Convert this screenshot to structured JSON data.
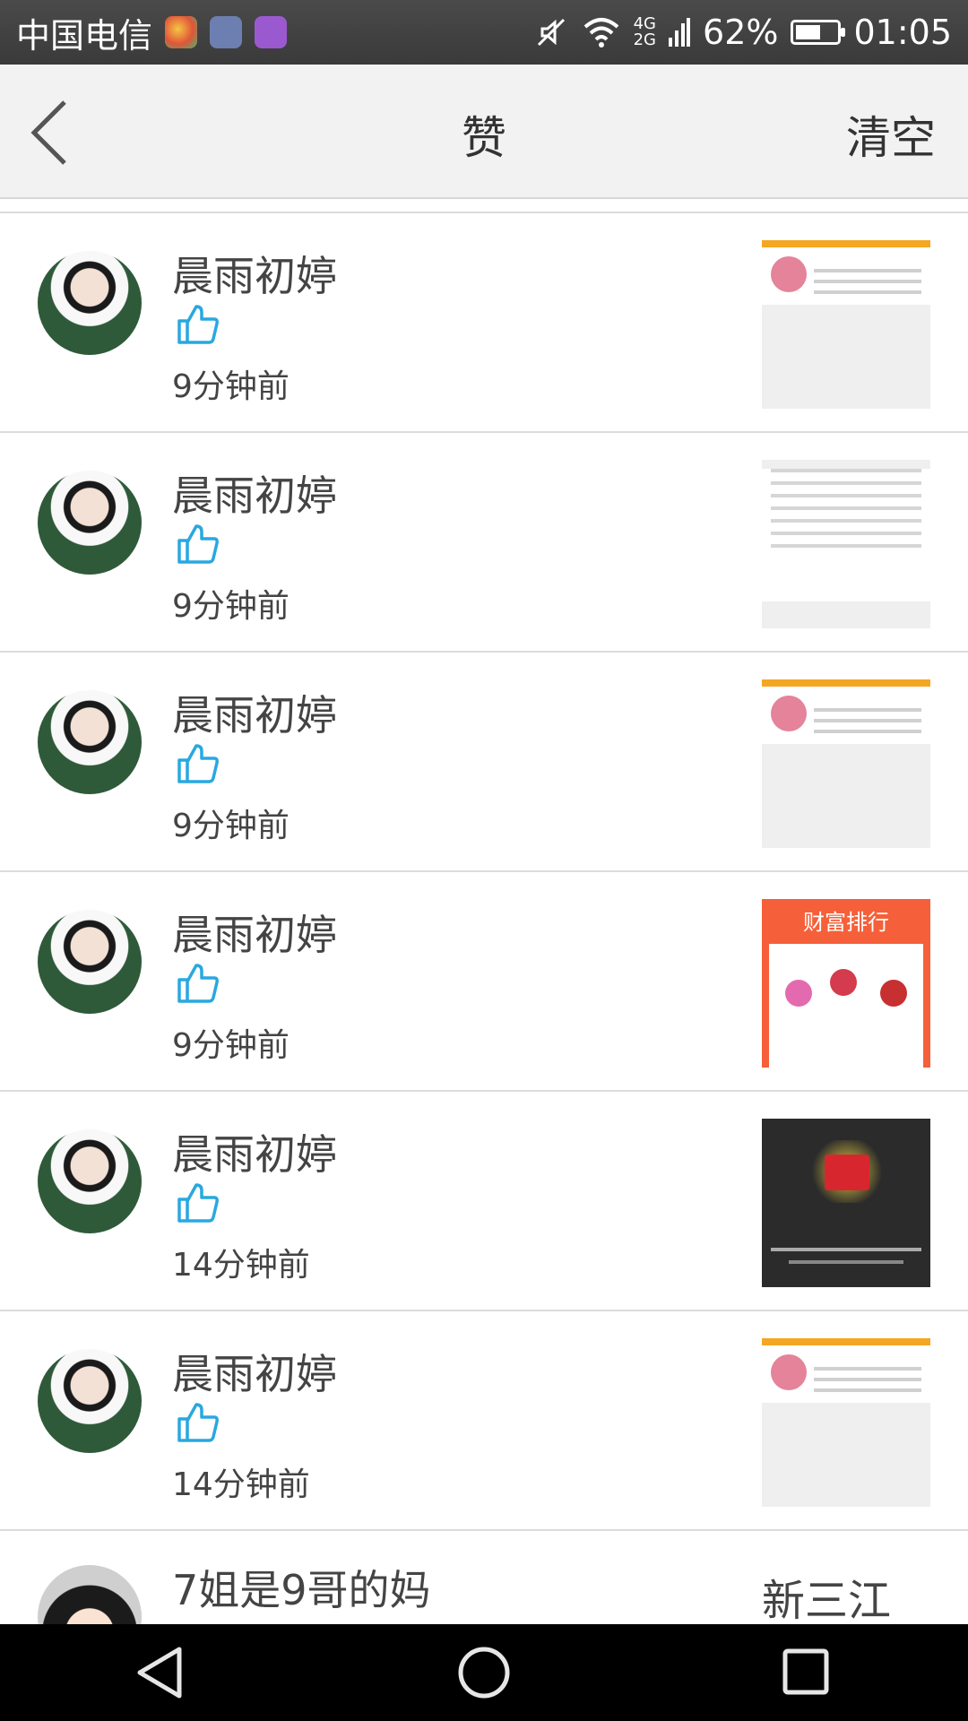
{
  "status_bar": {
    "carrier": "中国电信",
    "network_top": "4G",
    "network_bottom": "2G",
    "battery_percent": "62%",
    "battery_level": 0.62,
    "time": "01:05"
  },
  "header": {
    "title": "赞",
    "clear_label": "清空"
  },
  "likes": [
    {
      "user": "晨雨初婷",
      "time": "9分钟前",
      "thumbnail": "task-card"
    },
    {
      "user": "晨雨初婷",
      "time": "9分钟前",
      "thumbnail": "document"
    },
    {
      "user": "晨雨初婷",
      "time": "9分钟前",
      "thumbnail": "task-card"
    },
    {
      "user": "晨雨初婷",
      "time": "9分钟前",
      "thumbnail": "wealth-ranking",
      "thumbnail_title": "财富排行"
    },
    {
      "user": "晨雨初婷",
      "time": "14分钟前",
      "thumbnail": "red-envelope"
    },
    {
      "user": "晨雨初婷",
      "time": "14分钟前",
      "thumbnail": "task-card"
    }
  ],
  "partial_item": {
    "user": "7姐是9哥的妈",
    "right_text": "新三江"
  },
  "colors": {
    "accent_like": "#29a8e0",
    "status_bar_bg": "#3a3a3a",
    "nav_bg": "#f2f2f2"
  },
  "icons": {
    "back": "chevron-left-icon",
    "like": "thumbs-up-icon",
    "mute": "mute-icon",
    "wifi": "wifi-icon",
    "signal": "signal-icon",
    "battery": "battery-icon",
    "sys_back": "triangle-back-icon",
    "sys_home": "circle-home-icon",
    "sys_recents": "square-recents-icon"
  }
}
